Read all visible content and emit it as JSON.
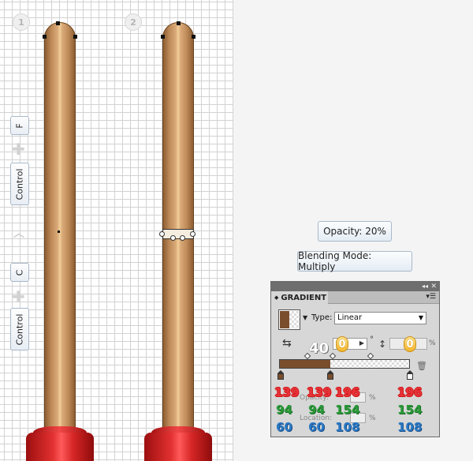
{
  "steps": [
    "1",
    "2"
  ],
  "keys": {
    "f": "F",
    "control_top": "Control",
    "c": "C",
    "control_bottom": "Control"
  },
  "callouts": {
    "opacity": "Opacity: 20%",
    "blending": "Blending Mode: Multiply"
  },
  "panel": {
    "tab": "GRADIENT",
    "type_label": "Type:",
    "type_value": "Linear",
    "angle_overlay": "40",
    "angle_value": "0",
    "aspect_value": "0",
    "opacity_label": "Opacity:",
    "location_label": "Location:",
    "percent": "%"
  },
  "rgb": {
    "red": [
      "139",
      "139",
      "196",
      "196"
    ],
    "green": [
      "94",
      "94",
      "154",
      "154"
    ],
    "blue": [
      "60",
      "60",
      "108",
      "108"
    ]
  },
  "colors": {
    "brown_stop": "#7a4e2d",
    "white_stop": "#ffffff",
    "red_text": "#e8333a",
    "green_text": "#2b9a3a",
    "blue_text": "#2a78c4"
  }
}
